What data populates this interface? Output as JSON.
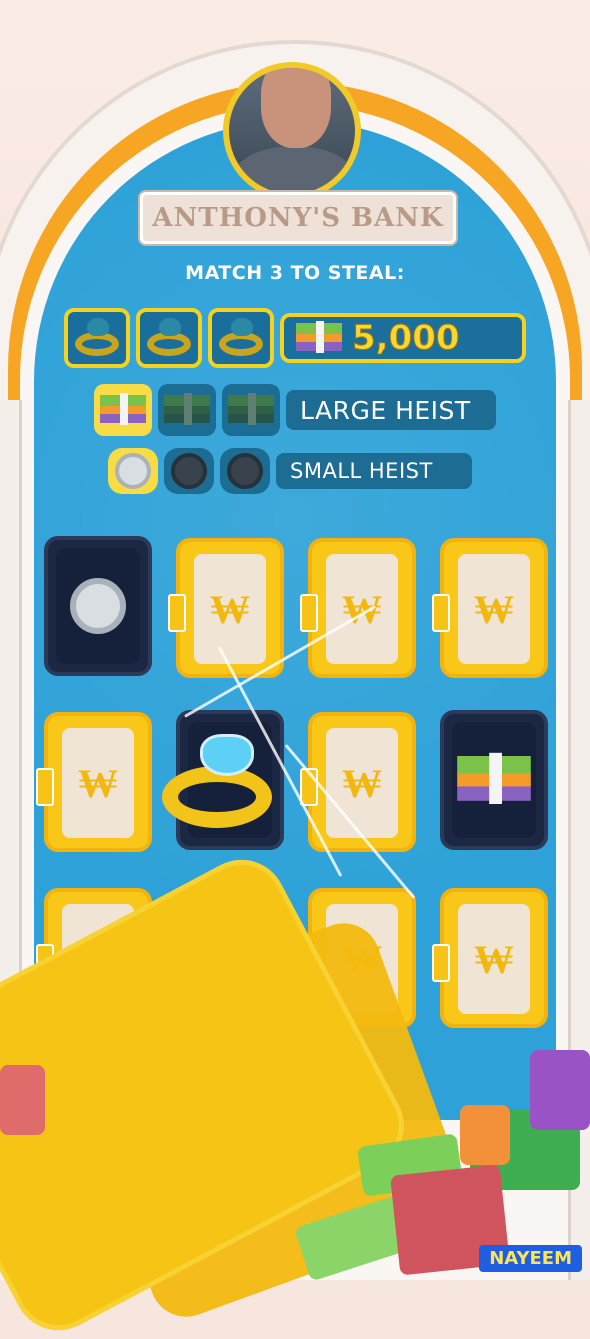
{
  "bank": {
    "title": "ANTHONY'S BANK"
  },
  "steal": {
    "header": "MATCH 3 TO STEAL:",
    "jackpot_amount": "5,000",
    "tiers": [
      {
        "label": "LARGE HEIST",
        "icon": "cash-stack-icon"
      },
      {
        "label": "SMALL HEIST",
        "icon": "coin-icon"
      }
    ]
  },
  "vault_symbol": "₩",
  "watermark": "NAYEEM",
  "colors": {
    "vault_bg": "#2ea2d8",
    "gold": "#f8c718",
    "arch_orange": "#f6a623"
  }
}
